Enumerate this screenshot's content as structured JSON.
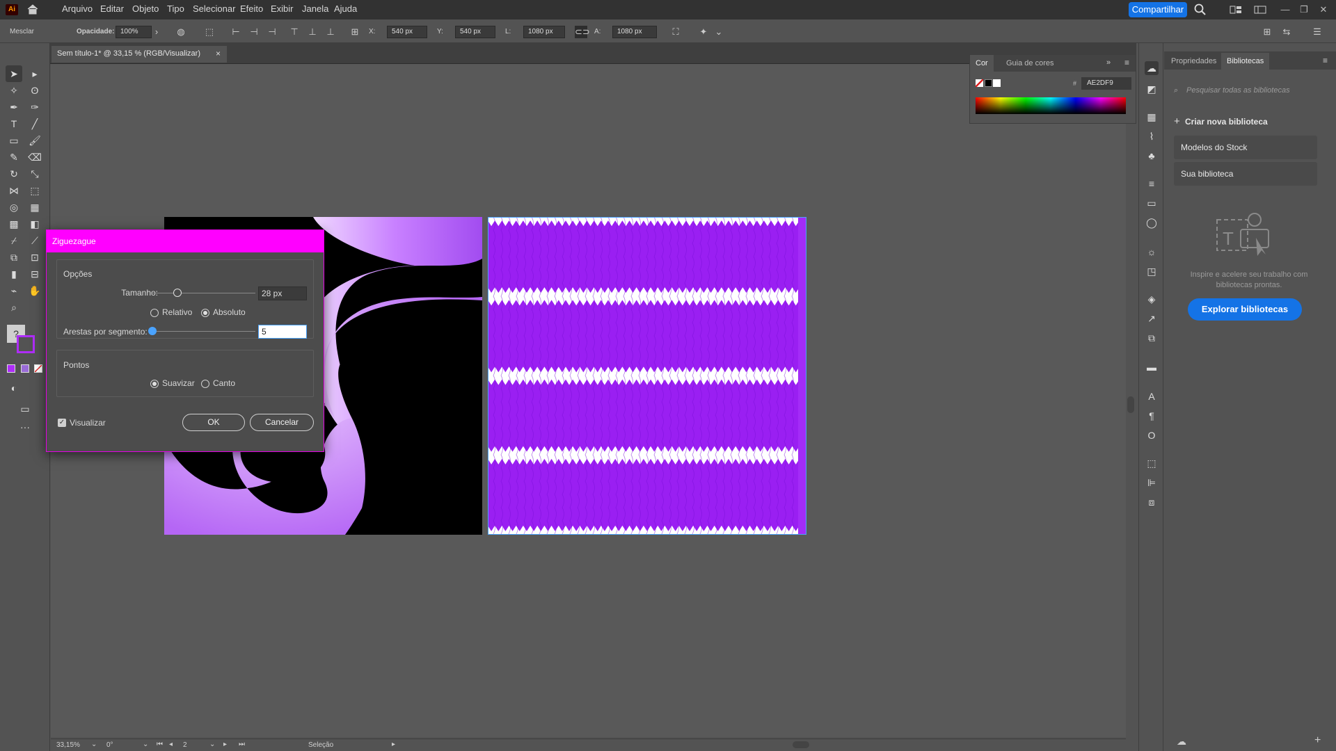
{
  "app": {
    "logo": "Ai"
  },
  "menu": [
    "Arquivo",
    "Editar",
    "Objeto",
    "Tipo",
    "Selecionar",
    "Efeito",
    "Exibir",
    "Janela",
    "Ajuda"
  ],
  "share_label": "Compartilhar",
  "control_bar": {
    "mode": "Mesclar",
    "opacity_label": "Opacidade:",
    "opacity": "100%",
    "x_label": "X:",
    "x": "540 px",
    "y_label": "Y:",
    "y": "540 px",
    "w_label": "L:",
    "w": "1080 px",
    "h_label": "A:",
    "h": "1080 px"
  },
  "document_tab": {
    "title": "Sem título-1* @ 33,15 % (RGB/Visualizar)",
    "close": "×"
  },
  "dialog": {
    "title": "Ziguezague",
    "options_group": "Opções",
    "size_label": "Tamanho:",
    "size_value": "28 px",
    "size_fraction": 0.25,
    "relative_label": "Relativo",
    "absolute_label": "Absoluto",
    "ridges_label": "Arestas por segmento:",
    "ridges_value": "5",
    "ridges_fraction": 0.0,
    "points_group": "Pontos",
    "smooth_label": "Suavizar",
    "corner_label": "Canto",
    "preview_label": "Visualizar",
    "ok_label": "OK",
    "cancel_label": "Cancelar"
  },
  "color_panel": {
    "tab_color": "Cor",
    "tab_guide": "Guia de cores",
    "hex_symbol": "#",
    "hex_value": "AE2DF9"
  },
  "libraries": {
    "tab_properties": "Propriedades",
    "tab_libraries": "Bibliotecas",
    "search_placeholder": "Pesquisar todas as bibliotecas",
    "create_label": "Criar nova biblioteca",
    "items": [
      "Modelos do Stock",
      "Sua biblioteca"
    ],
    "promo_text": "Inspire e acelere seu trabalho com bibliotecas prontas.",
    "explore_label": "Explorar bibliotecas"
  },
  "status": {
    "zoom": "33,15%",
    "rotation": "0°",
    "artboard": "2",
    "tool": "Seleção"
  },
  "colors": {
    "accent": "#1473e6",
    "fill": "#ae2df9",
    "dialog_title_bar": "#ff00ff",
    "art_purple": "#9a1ff2",
    "shape_light": "#d9a4ff"
  },
  "icons": [
    "home-icon",
    "search-icon",
    "arrange-icon",
    "workspace-icon",
    "selection-icon",
    "direct-selection-icon",
    "pen-icon",
    "type-icon",
    "rectangle-icon",
    "brush-icon",
    "rotate-icon",
    "scale-icon",
    "zoom-icon",
    "hand-icon"
  ]
}
